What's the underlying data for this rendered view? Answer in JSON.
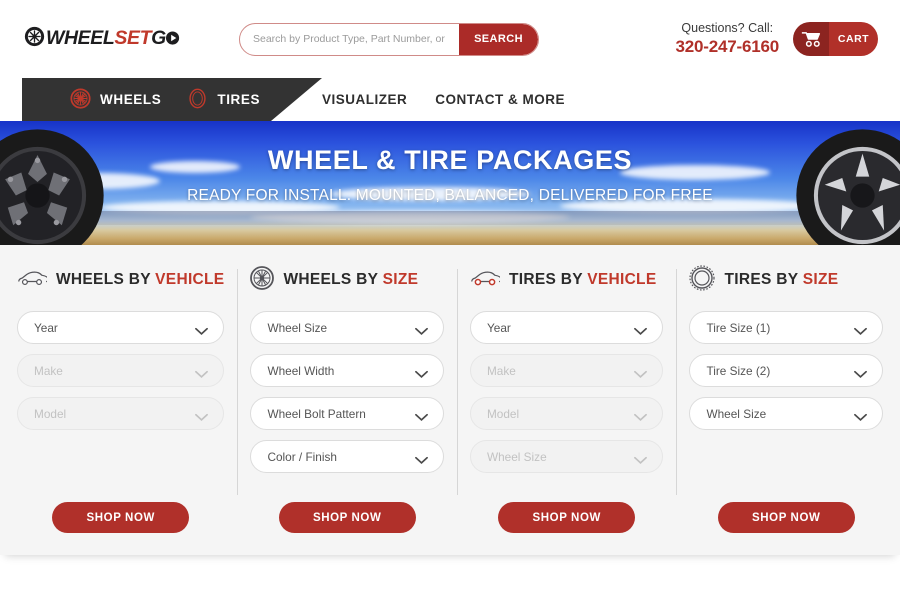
{
  "brand": {
    "logo_icon": "wheel-icon",
    "name_part1": "WHEEL",
    "name_part2": "SET",
    "name_part3": "G",
    "name_part4": "O",
    "accent_color": "#c0392b"
  },
  "search": {
    "placeholder": "Search by Product Type, Part Number, or Brand...",
    "value": "",
    "button_label": "SEARCH",
    "button_color": "#ab2b28"
  },
  "contact": {
    "question_label": "Questions? Call:",
    "phone": "320-247-6160",
    "phone_color": "#b03029"
  },
  "cart": {
    "label": "CART",
    "icon": "shopping-cart-icon"
  },
  "nav": {
    "dark_items": [
      {
        "label": "WHEELS",
        "icon": "wheel-spoke-icon"
      },
      {
        "label": "TIRES",
        "icon": "tire-ring-icon"
      }
    ],
    "light_items": [
      {
        "label": "VISUALIZER"
      },
      {
        "label": "CONTACT & MORE"
      }
    ]
  },
  "hero": {
    "title": "WHEEL & TIRE PACKAGES",
    "subtitle": "READY FOR INSTALL. MOUNTED, BALANCED, DELIVERED FOR FREE"
  },
  "finder": {
    "columns": [
      {
        "icon": "car-side-icon",
        "title_prefix": "WHEELS BY ",
        "title_accent": "VEHICLE",
        "fields": [
          {
            "label": "Year",
            "disabled": false
          },
          {
            "label": "Make",
            "disabled": true
          },
          {
            "label": "Model",
            "disabled": true
          }
        ],
        "button_label": "SHOP NOW"
      },
      {
        "icon": "wheel-rim-icon",
        "title_prefix": "WHEELS BY ",
        "title_accent": "SIZE",
        "fields": [
          {
            "label": "Wheel Size",
            "disabled": false
          },
          {
            "label": "Wheel Width",
            "disabled": false
          },
          {
            "label": "Wheel Bolt Pattern",
            "disabled": false
          },
          {
            "label": "Color / Finish",
            "disabled": false
          }
        ],
        "button_label": "SHOP NOW"
      },
      {
        "icon": "car-tire-icon",
        "title_prefix": "TIRES BY ",
        "title_accent": "VEHICLE",
        "fields": [
          {
            "label": "Year",
            "disabled": false
          },
          {
            "label": "Make",
            "disabled": true
          },
          {
            "label": "Model",
            "disabled": true
          },
          {
            "label": "Wheel Size",
            "disabled": true
          }
        ],
        "button_label": "SHOP NOW"
      },
      {
        "icon": "tire-ring-icon",
        "title_prefix": "TIRES BY ",
        "title_accent": "SIZE",
        "fields": [
          {
            "label": "Tire Size (1)",
            "disabled": false
          },
          {
            "label": "Tire Size (2)",
            "disabled": false
          },
          {
            "label": "Wheel Size",
            "disabled": false
          }
        ],
        "button_label": "SHOP NOW"
      }
    ]
  }
}
